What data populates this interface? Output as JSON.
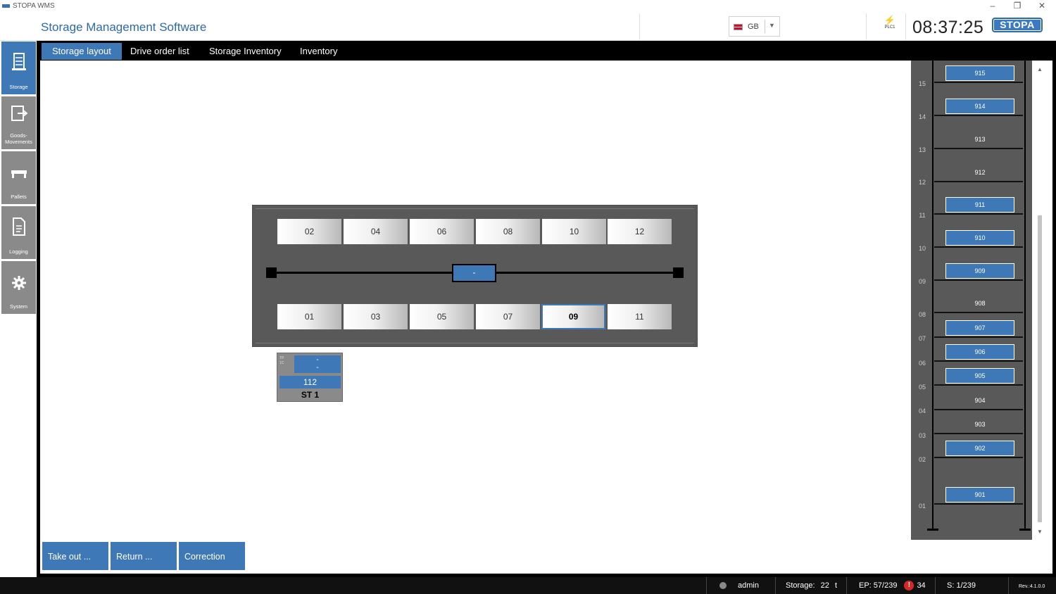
{
  "window": {
    "app_name": "STOPA WMS",
    "min_glyph": "–",
    "restore_glyph": "❐",
    "close_glyph": "✕"
  },
  "header": {
    "title": "Storage Management Software",
    "language_code": "GB",
    "language_dropdown_icon": "chevron-down-icon",
    "plc_label": "PLC1",
    "plc_status_color": "#2f7d32",
    "clock": "08:37:25",
    "logo_text": "STOPA"
  },
  "tabs": [
    {
      "label": "Storage layout",
      "active": true
    },
    {
      "label": "Drive order list",
      "active": false
    },
    {
      "label": "Storage Inventory",
      "active": false
    },
    {
      "label": "Inventory",
      "active": false
    }
  ],
  "sidebar": {
    "items": [
      {
        "label": "Storage",
        "icon": "storage-icon",
        "active": true
      },
      {
        "label": "Goods-\nMovements",
        "icon": "goods-movements-icon",
        "active": false
      },
      {
        "label": "Pallets",
        "icon": "pallets-icon",
        "active": false
      },
      {
        "label": "Logging",
        "icon": "logging-icon",
        "active": false
      },
      {
        "label": "System",
        "icon": "gear-icon",
        "active": false
      }
    ]
  },
  "layout": {
    "top_slots": [
      "02",
      "04",
      "06",
      "08",
      "10",
      "12"
    ],
    "bottom_slots": [
      "01",
      "03",
      "05",
      "07",
      "09",
      "11"
    ],
    "selected_slot": "09",
    "shuttle_label": "-",
    "station": {
      "side_tag": "TP 1C",
      "mini_top": "-",
      "mini_bottom": "-",
      "number": "112",
      "label": "ST 1"
    }
  },
  "rack": {
    "levels": [
      "15",
      "14",
      "13",
      "12",
      "11",
      "10",
      "09",
      "08",
      "07",
      "06",
      "05",
      "04",
      "03",
      "02",
      "01"
    ],
    "positions": [
      {
        "id": "915",
        "occupied": true
      },
      {
        "id": "914",
        "occupied": true
      },
      {
        "id": "913",
        "occupied": false
      },
      {
        "id": "912",
        "occupied": false
      },
      {
        "id": "911",
        "occupied": true
      },
      {
        "id": "910",
        "occupied": true
      },
      {
        "id": "909",
        "occupied": true
      },
      {
        "id": "908",
        "occupied": false
      },
      {
        "id": "907",
        "occupied": true
      },
      {
        "id": "906",
        "occupied": true
      },
      {
        "id": "905",
        "occupied": true
      },
      {
        "id": "904",
        "occupied": false
      },
      {
        "id": "903",
        "occupied": false
      },
      {
        "id": "902",
        "occupied": true
      },
      {
        "id": "901",
        "occupied": true
      }
    ]
  },
  "actions": {
    "take_out": "Take out ...",
    "return": "Return ...",
    "correction": "Correction"
  },
  "status": {
    "user": "admin",
    "storage_label": "Storage:",
    "storage_value": "22",
    "storage_unit": "t",
    "ep": "EP: 57/239",
    "alert_glyph": "!",
    "alert_count": "34",
    "s": "S: 1/239",
    "revision": "Rev.:4.1.0.0"
  },
  "colors": {
    "accent": "#3e78b6",
    "panel": "#595959",
    "alert": "#d62828"
  }
}
